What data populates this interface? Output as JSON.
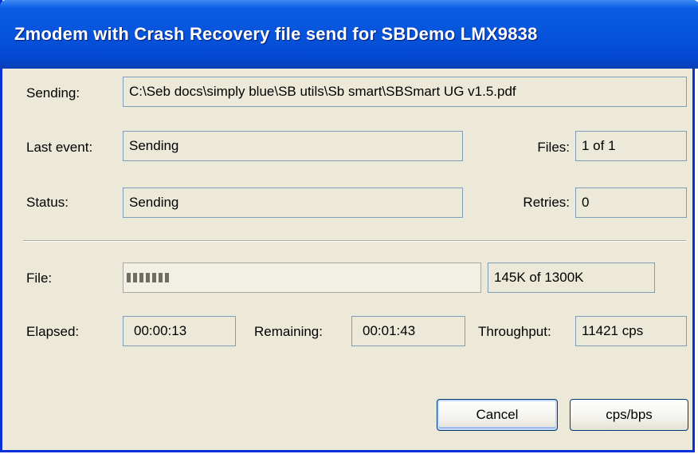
{
  "window": {
    "title": "Zmodem with Crash Recovery file send for SBDemo LMX9838"
  },
  "sending": {
    "label": "Sending:",
    "value": "C:\\Seb docs\\simply blue\\SB utils\\Sb smart\\SBSmart UG v1.5.pdf"
  },
  "last_event": {
    "label": "Last event:",
    "value": "Sending"
  },
  "files": {
    "label": "Files:",
    "value": "1 of 1"
  },
  "status": {
    "label": "Status:",
    "value": "Sending"
  },
  "retries": {
    "label": "Retries:",
    "value": "0"
  },
  "file": {
    "label": "File:",
    "progress_fraction": 0.11,
    "size_value": "145K of 1300K"
  },
  "elapsed": {
    "label": "Elapsed:",
    "value": "00:00:13"
  },
  "remaining": {
    "label": "Remaining:",
    "value": "00:01:43"
  },
  "throughput": {
    "label": "Throughput:",
    "value": "11421 cps"
  },
  "buttons": {
    "cancel_label": "Cancel",
    "cps_bps_label": "cps/bps"
  },
  "colors": {
    "titlebar": "#0754dc",
    "dialog_background": "#ece9d8",
    "field_border": "#7f9db9"
  }
}
